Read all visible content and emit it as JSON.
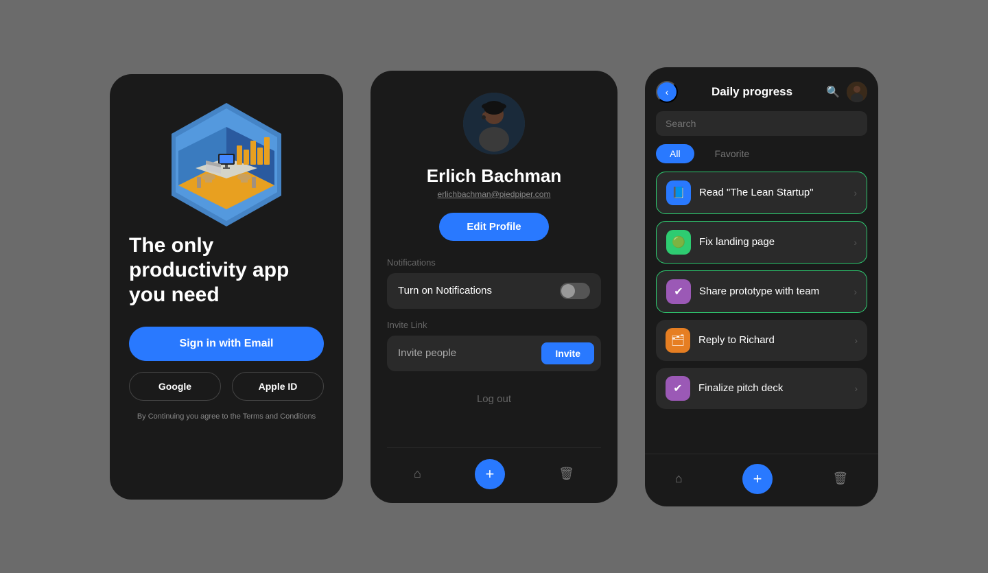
{
  "screen1": {
    "title": "The only productivity app you need",
    "sign_in_email": "Sign in with Email",
    "google": "Google",
    "apple_id": "Apple ID",
    "terms": "By Continuing you agree to the Terms and Conditions"
  },
  "screen2": {
    "user_name": "Erlich Bachman",
    "user_email": "erlichbachman@piedpiper.com",
    "edit_profile": "Edit Profile",
    "notifications_label": "Notifications",
    "notifications_toggle_label": "Turn on Notifications",
    "invite_link_label": "Invite Link",
    "invite_placeholder": "Invite people",
    "invite_btn": "Invite",
    "logout": "Log out"
  },
  "screen3": {
    "title": "Daily progress",
    "search_placeholder": "Search",
    "filter_all": "All",
    "filter_favorite": "Favorite",
    "tasks": [
      {
        "id": 1,
        "label": "Read \"The Lean Startup\"",
        "icon": "📘",
        "icon_bg": "#2979ff",
        "highlighted": true
      },
      {
        "id": 2,
        "label": "Fix landing page",
        "icon": "🟢",
        "icon_bg": "#2ecc71",
        "highlighted": true
      },
      {
        "id": 3,
        "label": "Share prototype with team",
        "icon": "✔",
        "icon_bg": "#9b59b6",
        "highlighted": true
      },
      {
        "id": 4,
        "label": "Reply to Richard",
        "icon": "🗂",
        "icon_bg": "#e67e22",
        "highlighted": false
      },
      {
        "id": 5,
        "label": "Finalize pitch deck",
        "icon": "✔",
        "icon_bg": "#9b59b6",
        "highlighted": false
      }
    ]
  },
  "icons": {
    "back": "‹",
    "home": "⌂",
    "trash": "🗑",
    "plus": "+",
    "search": "🔍"
  }
}
